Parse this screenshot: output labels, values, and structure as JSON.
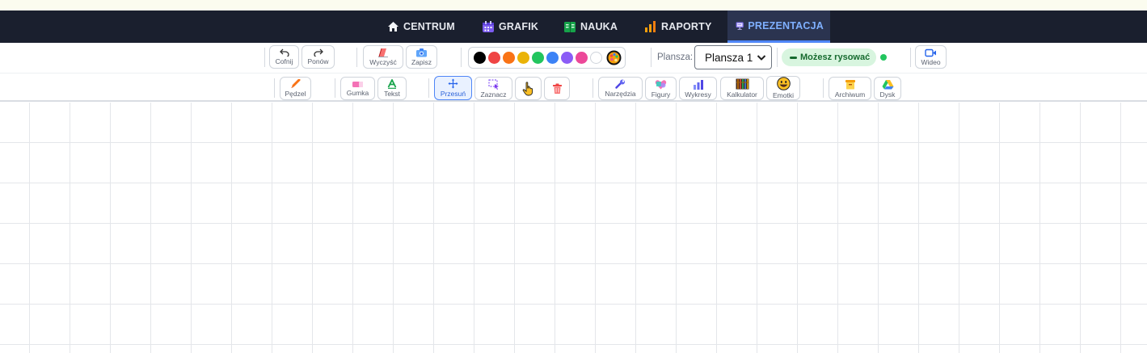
{
  "nav": {
    "items": [
      {
        "label": "CENTRUM",
        "icon": "home-icon"
      },
      {
        "label": "GRAFIK",
        "icon": "calendar-icon"
      },
      {
        "label": "NAUKA",
        "icon": "notebook-icon"
      },
      {
        "label": "RAPORTY",
        "icon": "bar-chart-icon"
      },
      {
        "label": "PREZENTACJA",
        "icon": "presentation-icon",
        "active": true
      }
    ]
  },
  "toolbar": {
    "undo": "Cofnij",
    "redo": "Ponów",
    "clear": "Wyczyść",
    "save": "Zapisz",
    "colors": [
      "#000000",
      "#ef4444",
      "#f97316",
      "#eab308",
      "#22c55e",
      "#3b82f6",
      "#8b5cf6",
      "#ec4899",
      "#ffffff"
    ],
    "board_label": "Plansza:",
    "board_value": "Plansza 1",
    "status_pill": "Możesz rysować",
    "video": "Wideo",
    "brush": "Pędzel",
    "eraser": "Gumka",
    "text": "Tekst",
    "move": "Przesuń",
    "select": "Zaznacz",
    "tools": "Narzędzia",
    "shapes": "Figury",
    "charts": "Wykresy",
    "calculator": "Kalkulator",
    "emoticons": "Emotki",
    "archive": "Archiwum",
    "drive": "Dysk"
  },
  "accent": "#4f86f7"
}
